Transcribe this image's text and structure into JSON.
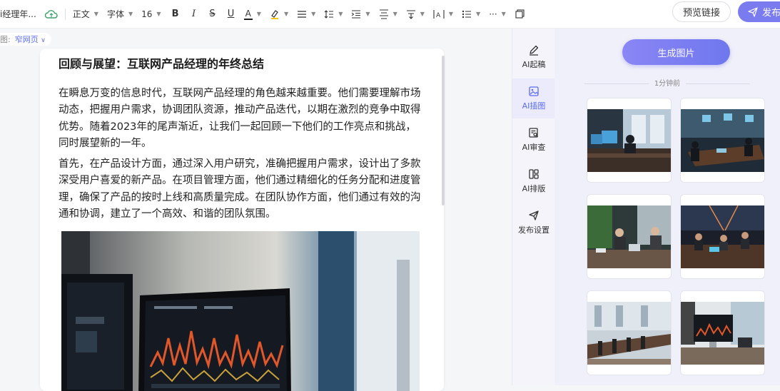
{
  "toolbar": {
    "doc_title": "ⅰ经理年...",
    "style_select": "正文",
    "font_select": "字体",
    "size_select": "16",
    "bold": "B",
    "italic": "I",
    "strike": "S",
    "underline": "U",
    "font_color": "A",
    "more": "···",
    "preview_label": "预览链接",
    "publish_label": "发布"
  },
  "breadcrumb": {
    "prefix": "图:",
    "mode": "窄网页"
  },
  "document": {
    "title": "回顾与展望：互联网产品经理的年终总结",
    "paragraphs": [
      "在瞬息万变的信息时代，互联网产品经理的角色越来越重要。他们需要理解市场动态，把握用户需求，协调团队资源，推动产品迭代，以期在激烈的竞争中取得优势。随着2023年的尾声渐近，让我们一起回顾一下他们的工作亮点和挑战，同时展望新的一年。",
      "首先，在产品设计方面，通过深入用户研究，准确把握用户需求，设计出了多款深受用户喜爱的新产品。在项目管理方面，他们通过精细化的任务分配和进度管理，确保了产品的按时上线和高质量完成。在团队协作方面，他们通过有效的沟通和协调，建立了一个高效、和谐的团队氛围。"
    ]
  },
  "ai_rail": {
    "items": [
      {
        "label": "AI起稿",
        "icon": "pen-icon"
      },
      {
        "label": "AI插图",
        "icon": "image-icon"
      },
      {
        "label": "AI审查",
        "icon": "review-icon"
      },
      {
        "label": "AI排版",
        "icon": "layout-icon"
      },
      {
        "label": "发布设置",
        "icon": "send-icon"
      }
    ]
  },
  "ai_panel": {
    "generate_label": "生成图片",
    "time_label": "1分钟前"
  },
  "colors": {
    "accent": "#7b7bf0",
    "active_text": "#5b6cf0"
  }
}
